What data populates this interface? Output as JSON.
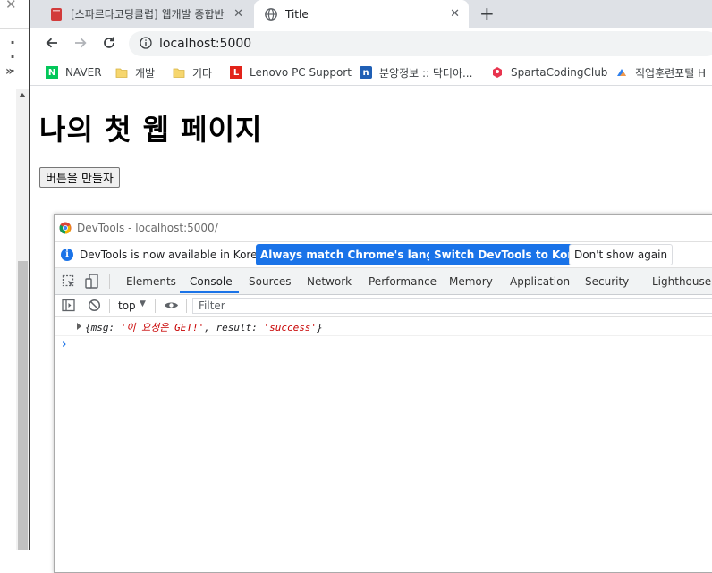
{
  "browser": {
    "tabs": [
      {
        "title": "[스파르타코딩클럽] 웹개발 종합반",
        "active": false
      },
      {
        "title": "Title",
        "active": true
      }
    ],
    "address": "localhost:5000",
    "bookmarks": [
      {
        "label": "NAVER",
        "icon": "naver-icon",
        "color": "#03c75a"
      },
      {
        "label": "개발",
        "icon": "folder-icon",
        "color": "#f6d66e"
      },
      {
        "label": "기타",
        "icon": "folder-icon",
        "color": "#f6d66e"
      },
      {
        "label": "Lenovo PC Support",
        "icon": "lenovo-icon",
        "color": "#e2231a"
      },
      {
        "label": "분양정보 :: 닥터아...",
        "icon": "drapt-icon",
        "color": "#1f5fb5"
      },
      {
        "label": "SpartaCodingClub",
        "icon": "sparta-icon",
        "color": "#e8344e"
      },
      {
        "label": "직업훈련포털 H",
        "icon": "hrd-icon",
        "color": "#2f80ed"
      }
    ]
  },
  "page": {
    "heading": "나의 첫 웹 페이지",
    "button_label": "버튼을 만들자"
  },
  "devtools": {
    "title": "DevTools - localhost:5000/",
    "infobar": {
      "message": "DevTools is now available in Korean!",
      "match_language": "Always match Chrome's language",
      "switch_korean": "Switch DevTools to Korean",
      "dont_show": "Don't show again"
    },
    "tabs": [
      "Elements",
      "Console",
      "Sources",
      "Network",
      "Performance",
      "Memory",
      "Application",
      "Security",
      "Lighthouse"
    ],
    "active_tab": "Console",
    "context": "top",
    "filter_placeholder": "Filter",
    "log": {
      "prefix": "{msg: ",
      "msg_value": "'이 요청은 GET!'",
      "middle": ", result: ",
      "result_value": "'success'",
      "suffix": "}"
    },
    "prompt": "›"
  },
  "colors": {
    "accent": "#1a73e8",
    "string": "#c80000",
    "tabstrip": "#dee1e6"
  }
}
